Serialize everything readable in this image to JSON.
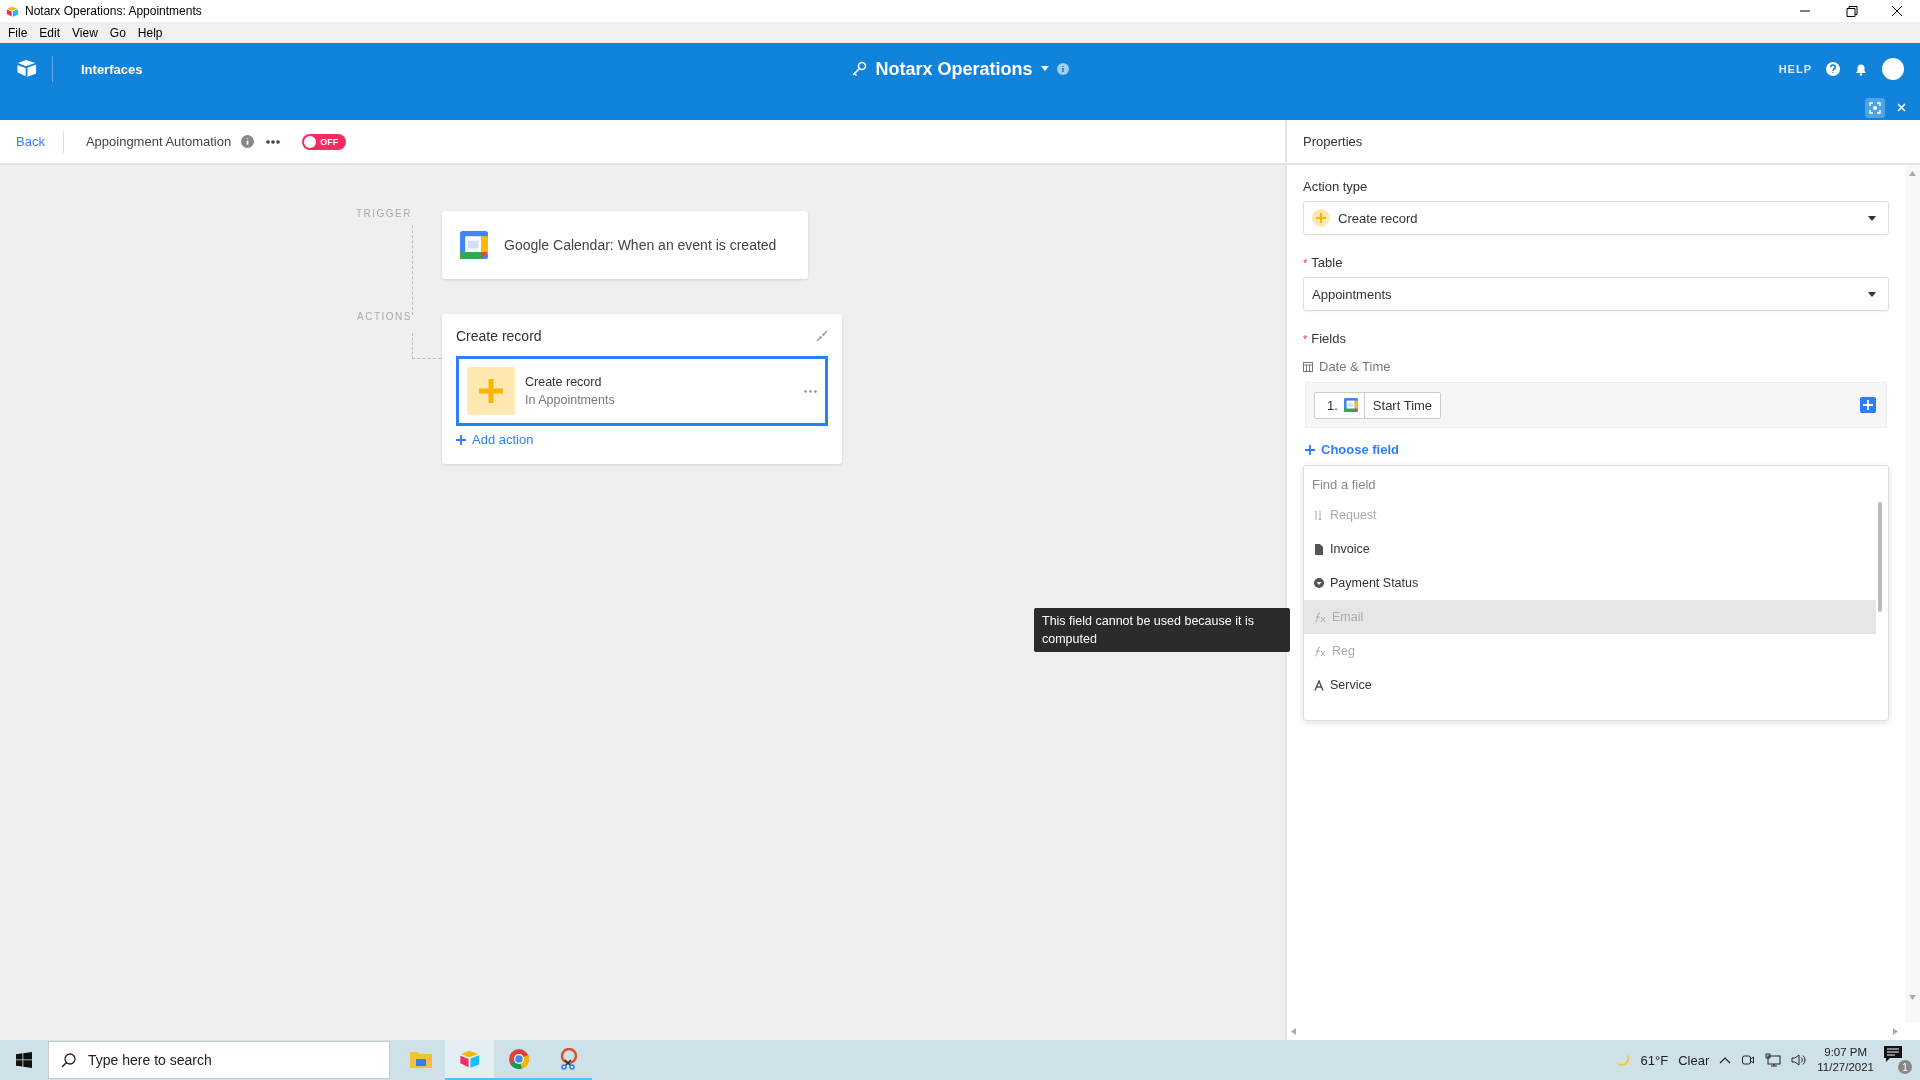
{
  "window": {
    "title": "Notarx Operations: Appointments",
    "menu": [
      "File",
      "Edit",
      "View",
      "Go",
      "Help"
    ]
  },
  "header": {
    "nav_link": "Interfaces",
    "base_name": "Notarx Operations",
    "help": "HELP"
  },
  "toolbar": {
    "back": "Back",
    "automation_name": "Appoingment Automation",
    "toggle": {
      "label": "OFF",
      "on": false
    }
  },
  "canvas": {
    "trigger_label": "TRIGGER",
    "trigger": "Google Calendar: When an event is created",
    "actions_label": "ACTIONS",
    "action_group": {
      "title": "Create record",
      "action": {
        "title": "Create record",
        "subtitle": "In Appointments",
        "selected": true
      },
      "add_action": "Add action"
    }
  },
  "properties": {
    "title": "Properties",
    "action_type_label": "Action type",
    "action_type": "Create record",
    "table_label": {
      "text": "Table",
      "required_mark": "*"
    },
    "table": "Appointments",
    "fields_label": {
      "text": "Fields",
      "required_mark": "*"
    },
    "field": {
      "name": "Date & Time",
      "token_index": "1.",
      "token": "Start Time"
    },
    "choose_field": "Choose field",
    "picker": {
      "placeholder": "Find a field",
      "items": [
        {
          "name": "Request",
          "kind": "number",
          "disabled": true,
          "highlighted": false
        },
        {
          "name": "Invoice",
          "kind": "attachment",
          "disabled": false,
          "highlighted": false
        },
        {
          "name": "Payment Status",
          "kind": "select",
          "disabled": false,
          "highlighted": false
        },
        {
          "name": "Email",
          "kind": "formula",
          "disabled": true,
          "highlighted": true
        },
        {
          "name": "Reg",
          "kind": "formula",
          "disabled": true,
          "highlighted": false
        },
        {
          "name": "Service",
          "kind": "text",
          "disabled": false,
          "highlighted": false
        }
      ]
    }
  },
  "tooltip": "This field cannot be used because it is computed",
  "taskbar": {
    "search_placeholder": "Type here to search",
    "apps": [
      {
        "kind": "files",
        "running": false,
        "selected": false
      },
      {
        "kind": "airtable",
        "running": true,
        "selected": true
      },
      {
        "kind": "chrome",
        "running": true,
        "selected": false
      },
      {
        "kind": "snip",
        "running": true,
        "selected": false
      }
    ],
    "temperature": "61°F",
    "weather": "Clear",
    "time": "9:07 PM",
    "date": "11/27/2021",
    "notifications": "1"
  }
}
